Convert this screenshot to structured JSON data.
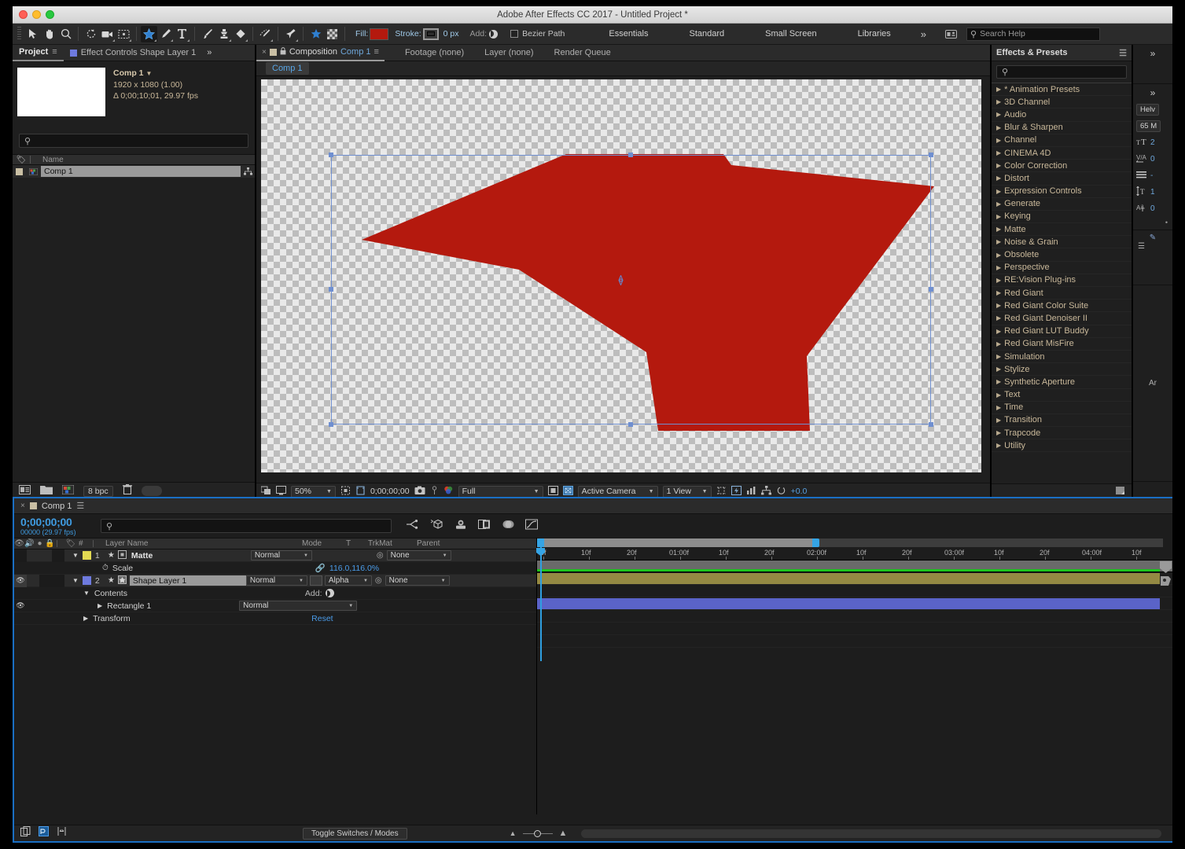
{
  "window": {
    "title": "Adobe After Effects CC 2017 - Untitled Project *"
  },
  "toolbar": {
    "fill_label": "Fill:",
    "fill_color": "#b4190e",
    "stroke_label": "Stroke:",
    "stroke_width": "0 px",
    "add_label": "Add:",
    "bezier_label": "Bezier Path",
    "workspaces": [
      "Essentials",
      "Standard",
      "Small Screen",
      "Libraries"
    ],
    "overflow_chevron": "»",
    "search_placeholder": "Search Help",
    "tools": [
      "selection-tool",
      "hand-tool",
      "zoom-tool",
      "rotation-tool",
      "camera-tool",
      "region-of-interest-tool",
      "shape-tool",
      "pen-tool",
      "type-tool",
      "brush-tool",
      "clone-stamp-tool",
      "eraser-tool",
      "roto-brush-tool",
      "puppet-pin-tool"
    ]
  },
  "project_panel": {
    "tab_project": "Project",
    "tab_effect_controls": "Effect Controls Shape Layer 1",
    "overflow": "»",
    "comp_name": "Comp 1",
    "comp_dropdown_glyph": "▼",
    "comp_resolution": "1920 x 1080 (1.00)",
    "comp_duration": "Δ 0;00;10;01, 29.97 fps",
    "search_placeholder": "",
    "column_name": "Name",
    "items": [
      {
        "name": "Comp 1"
      }
    ],
    "bit_depth": "8 bpc"
  },
  "comp_panel": {
    "close_glyph": "×",
    "tab_label_prefix": "Composition",
    "tab_label_name": "Comp 1",
    "tabs": [
      "Footage (none)",
      "Layer (none)",
      "Render Queue"
    ],
    "subtab": "Comp 1",
    "footer": {
      "zoom": "50%",
      "timecode": "0;00;00;00",
      "resolution": "Full",
      "camera": "Active Camera",
      "views": "1 View",
      "exposure": "+0.0"
    },
    "shape": {
      "fill_color": "#b4190e",
      "selection_stroke": "#7090d0"
    }
  },
  "effects_panel": {
    "title": "Effects & Presets",
    "menu_glyph": "☰",
    "search_placeholder": "",
    "categories": [
      "* Animation Presets",
      "3D Channel",
      "Audio",
      "Blur & Sharpen",
      "Channel",
      "CINEMA 4D",
      "Color Correction",
      "Distort",
      "Expression Controls",
      "Generate",
      "Keying",
      "Matte",
      "Noise & Grain",
      "Obsolete",
      "Perspective",
      "RE:Vision Plug-ins",
      "Red Giant",
      "Red Giant Color Suite",
      "Red Giant Denoiser II",
      "Red Giant LUT Buddy",
      "Red Giant MisFire",
      "Simulation",
      "Stylize",
      "Synthetic Aperture",
      "Text",
      "Time",
      "Transition",
      "Trapcode",
      "Utility"
    ]
  },
  "right_strip": {
    "overflow_top": "»",
    "overflow_second": "»",
    "font_family": "Helv",
    "font_style": "65 M",
    "font_size": "2",
    "tracking": "0",
    "leading": "-",
    "vertical_scale": "1",
    "baseline_shift": "0",
    "paragraph_label": "Ar",
    "menu_glyph": "☰"
  },
  "timeline": {
    "tab_name": "Comp 1",
    "close_glyph": "×",
    "menu_glyph": "☰",
    "current_time": "0;00;00;00",
    "current_frame": "00000 (29.97 fps)",
    "search_placeholder": "",
    "columns": {
      "number": "#",
      "layer_name": "Layer Name",
      "mode": "Mode",
      "t": "T",
      "trkmat": "TrkMat",
      "parent": "Parent"
    },
    "rows": [
      {
        "kind": "layer",
        "index": "1",
        "name": "Matte",
        "color": "#e3da52",
        "mode": "Normal",
        "trkmat": "",
        "parent": "None",
        "bar_color": "#948943",
        "visible": false,
        "selected": false
      },
      {
        "kind": "property",
        "name": "Scale",
        "value": "116.0,116.0%"
      },
      {
        "kind": "layer",
        "index": "2",
        "name": "Shape Layer 1",
        "color": "#6e7ade",
        "mode": "Normal",
        "trkmat": "Alpha",
        "parent": "None",
        "bar_color": "#5a63c8",
        "visible": true,
        "selected": true
      },
      {
        "kind": "group",
        "name": "Contents",
        "value": "Add:"
      },
      {
        "kind": "subgroup",
        "name": "Rectangle 1",
        "mode": "Normal"
      },
      {
        "kind": "group",
        "name": "Transform",
        "value": "Reset"
      }
    ],
    "ruler_ticks": [
      "0f",
      "10f",
      "20f",
      "01:00f",
      "10f",
      "20f",
      "02:00f",
      "10f",
      "20f",
      "03:00f",
      "10f",
      "20f",
      "04:00f",
      "10f"
    ],
    "footer": {
      "toggle_switches": "Toggle Switches / Modes"
    }
  }
}
